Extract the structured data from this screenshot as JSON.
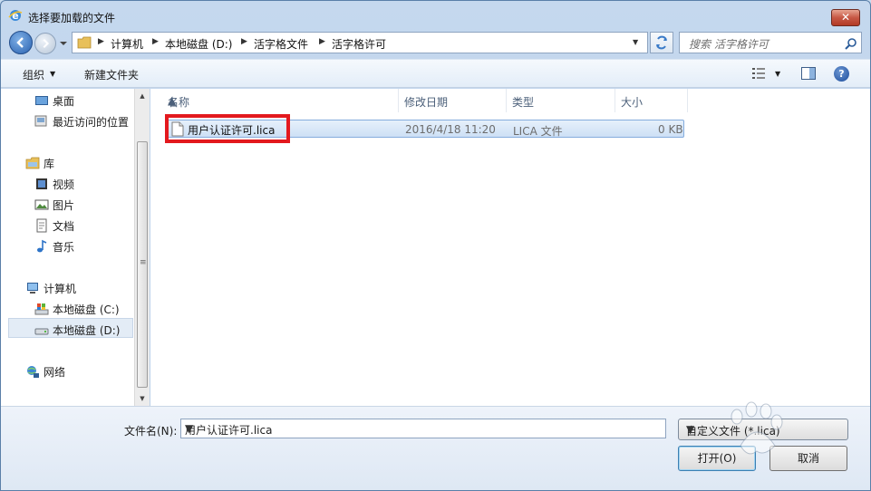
{
  "window": {
    "title": "选择要加载的文件",
    "close_label": "✕"
  },
  "address": {
    "breadcrumbs": [
      "计算机",
      "本地磁盘 (D:)",
      "活字格文件",
      "活字格许可"
    ],
    "search_placeholder": "搜索 活字格许可"
  },
  "toolbar": {
    "organize_label": "组织",
    "new_folder_label": "新建文件夹",
    "help_label": "?"
  },
  "sidebar": {
    "items": [
      {
        "label": "桌面",
        "icon": "desktop-icon"
      },
      {
        "label": "最近访问的位置",
        "icon": "recent-places-icon"
      },
      {
        "label": "库",
        "icon": "library-icon"
      },
      {
        "label": "视频",
        "icon": "video-icon"
      },
      {
        "label": "图片",
        "icon": "pictures-icon"
      },
      {
        "label": "文档",
        "icon": "documents-icon"
      },
      {
        "label": "音乐",
        "icon": "music-icon"
      },
      {
        "label": "计算机",
        "icon": "computer-icon"
      },
      {
        "label": "本地磁盘 (C:)",
        "icon": "drive-c-icon"
      },
      {
        "label": "本地磁盘 (D:)",
        "icon": "drive-d-icon",
        "selected": true
      },
      {
        "label": "网络",
        "icon": "network-icon"
      }
    ]
  },
  "file_list": {
    "columns": [
      "名称",
      "修改日期",
      "类型",
      "大小"
    ],
    "rows": [
      {
        "name": "用户认证许可.lica",
        "date": "2016/4/18 11:20",
        "type": "LICA 文件",
        "size": "0 KB"
      }
    ]
  },
  "footer": {
    "filename_label": "文件名(N):",
    "filename_value": "用户认证许可.lica",
    "filter_value": "自定义文件 (*.lica)",
    "open_label": "打开(O)",
    "cancel_label": "取消"
  },
  "colors": {
    "highlight": "#e3191e",
    "selection": "#cde0f5"
  }
}
